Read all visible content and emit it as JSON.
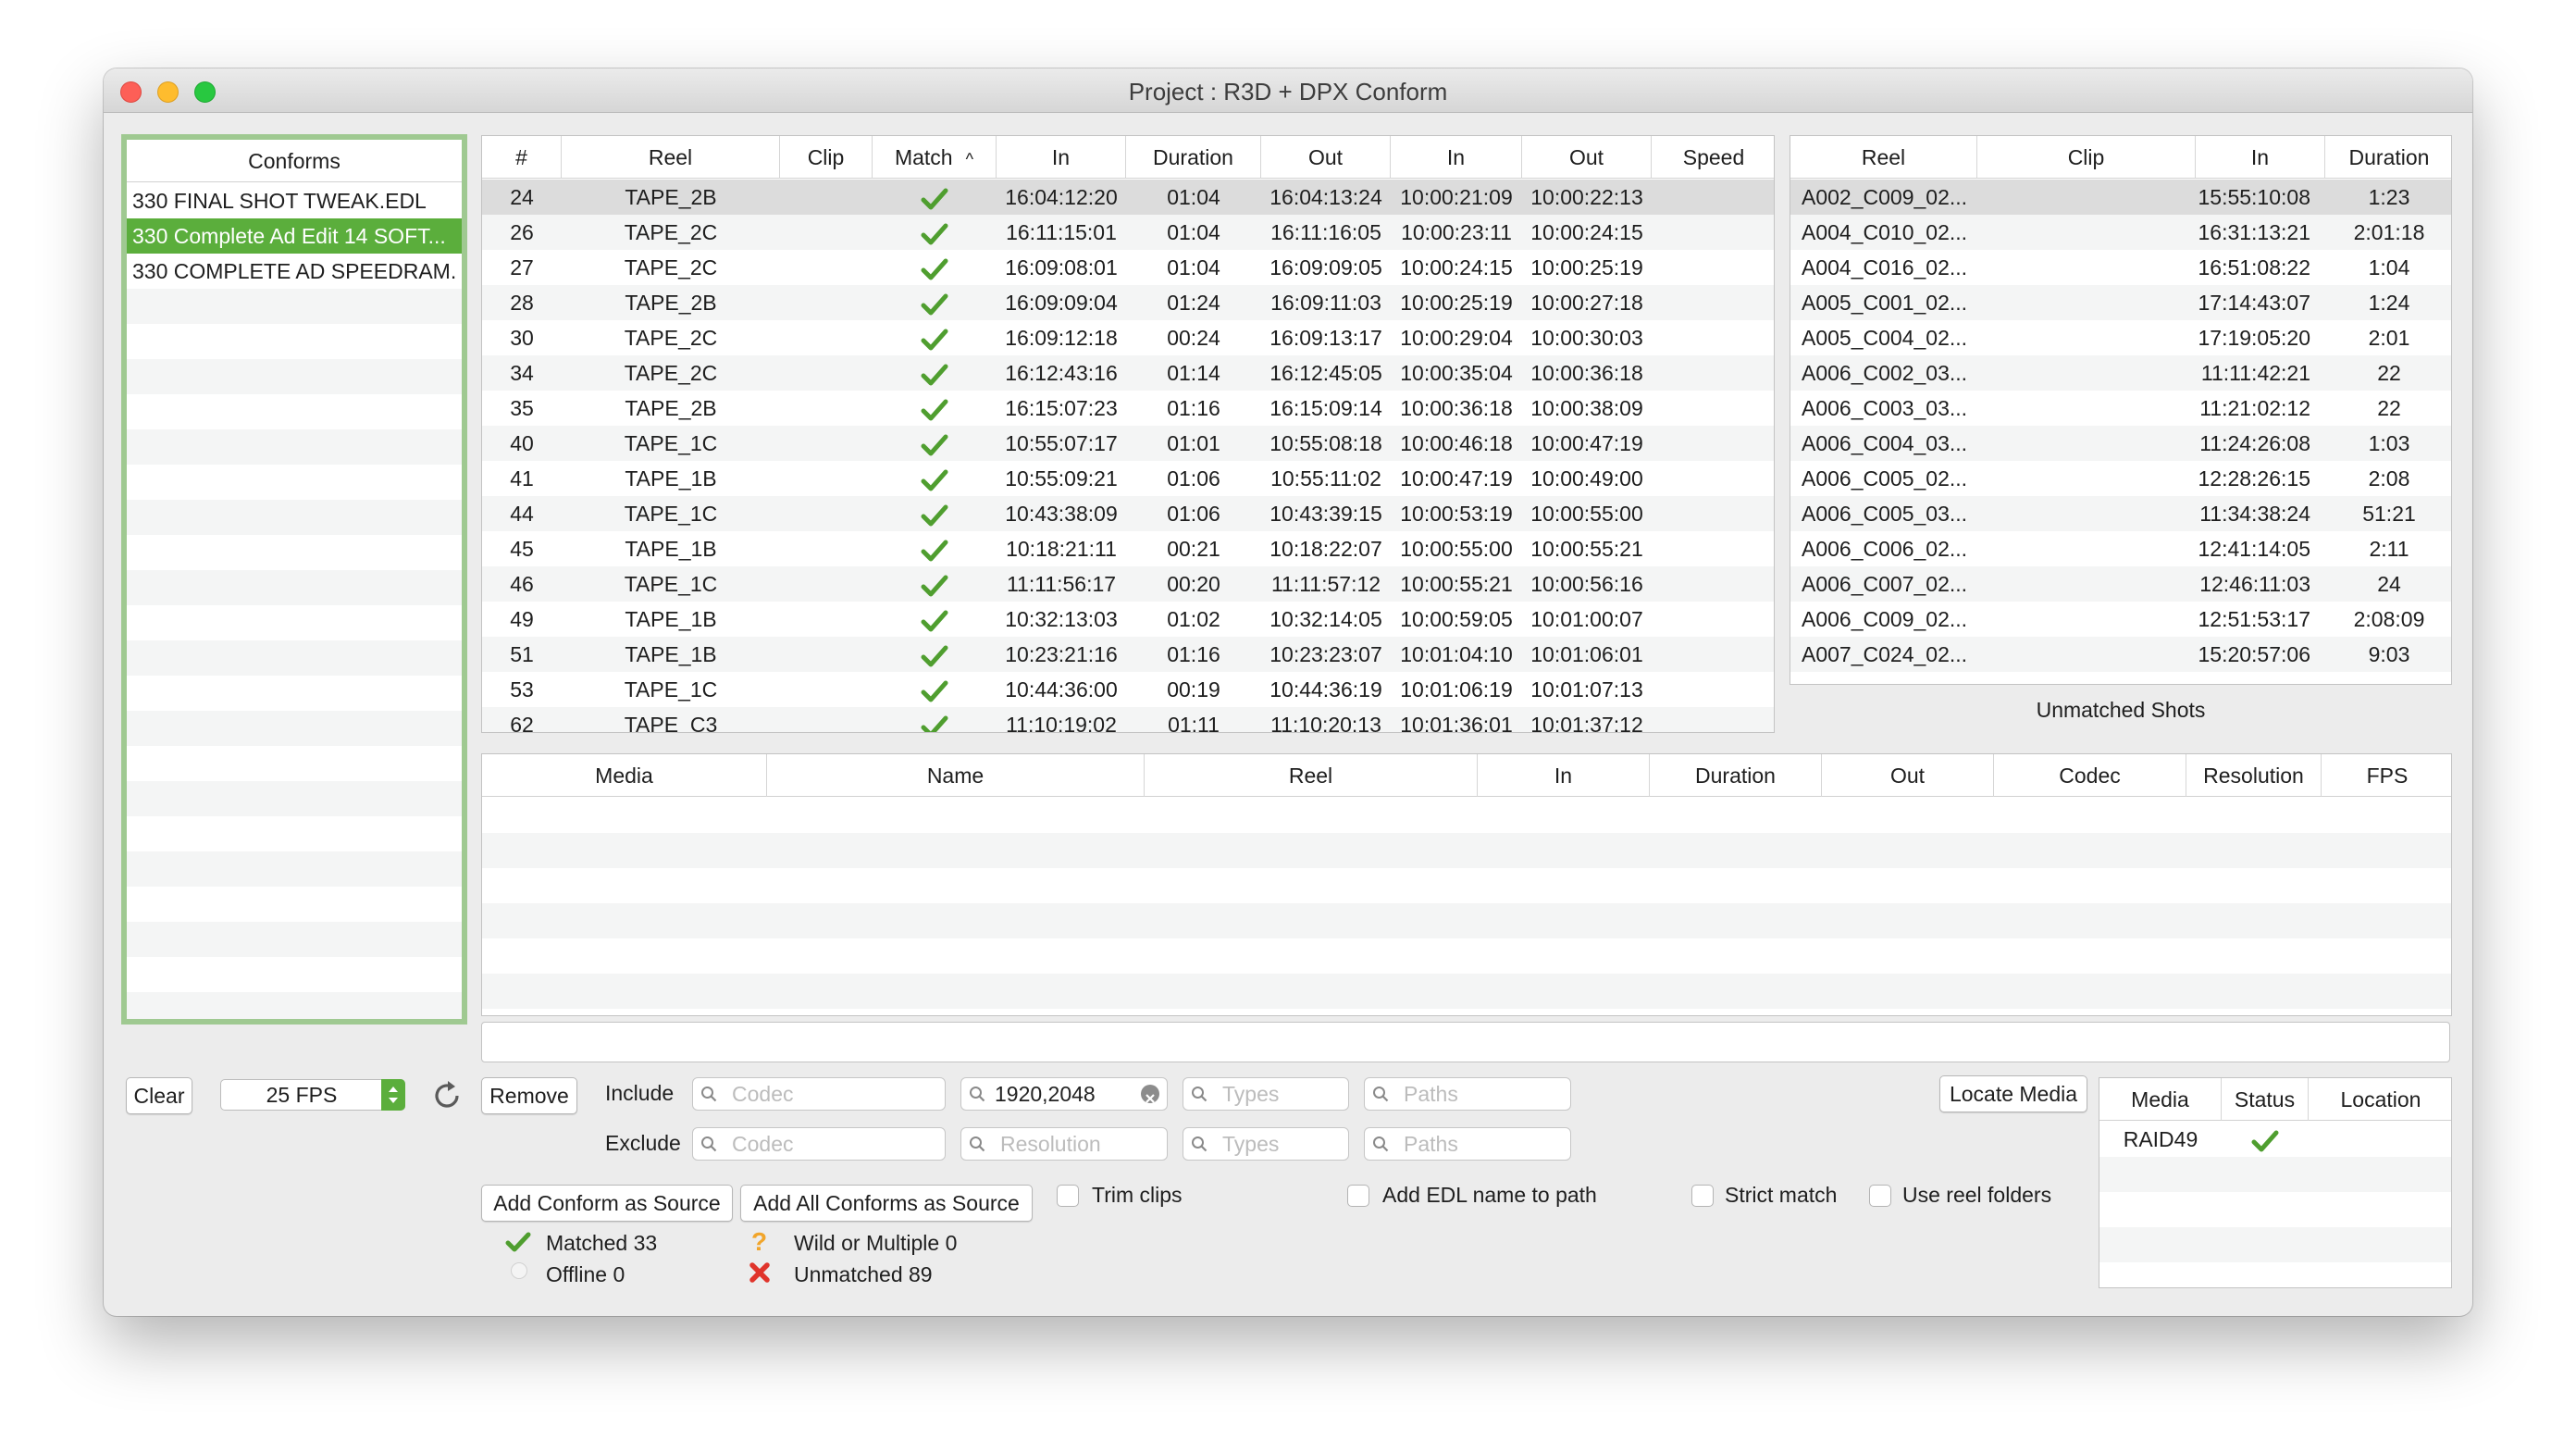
{
  "window": {
    "title": "Project : R3D + DPX Conform"
  },
  "conforms": {
    "header": "Conforms",
    "items": [
      "330  FINAL SHOT TWEAK.EDL",
      "330 Complete Ad Edit 14 SOFT...",
      "330 COMPLETE AD SPEEDRAM..."
    ],
    "selected_index": 1
  },
  "events": {
    "headers": [
      "#",
      "Reel",
      "Clip",
      "Match",
      "In",
      "Duration",
      "Out",
      "In",
      "Out",
      "Speed"
    ],
    "sort_indicator": "^",
    "rows": [
      [
        "24",
        "TAPE_2B",
        "",
        "check",
        "16:04:12:20",
        "01:04",
        "16:04:13:24",
        "10:00:21:09",
        "10:00:22:13",
        ""
      ],
      [
        "26",
        "TAPE_2C",
        "",
        "check",
        "16:11:15:01",
        "01:04",
        "16:11:16:05",
        "10:00:23:11",
        "10:00:24:15",
        ""
      ],
      [
        "27",
        "TAPE_2C",
        "",
        "check",
        "16:09:08:01",
        "01:04",
        "16:09:09:05",
        "10:00:24:15",
        "10:00:25:19",
        ""
      ],
      [
        "28",
        "TAPE_2B",
        "",
        "check",
        "16:09:09:04",
        "01:24",
        "16:09:11:03",
        "10:00:25:19",
        "10:00:27:18",
        ""
      ],
      [
        "30",
        "TAPE_2C",
        "",
        "check",
        "16:09:12:18",
        "00:24",
        "16:09:13:17",
        "10:00:29:04",
        "10:00:30:03",
        ""
      ],
      [
        "34",
        "TAPE_2C",
        "",
        "check",
        "16:12:43:16",
        "01:14",
        "16:12:45:05",
        "10:00:35:04",
        "10:00:36:18",
        ""
      ],
      [
        "35",
        "TAPE_2B",
        "",
        "check",
        "16:15:07:23",
        "01:16",
        "16:15:09:14",
        "10:00:36:18",
        "10:00:38:09",
        ""
      ],
      [
        "40",
        "TAPE_1C",
        "",
        "check",
        "10:55:07:17",
        "01:01",
        "10:55:08:18",
        "10:00:46:18",
        "10:00:47:19",
        ""
      ],
      [
        "41",
        "TAPE_1B",
        "",
        "check",
        "10:55:09:21",
        "01:06",
        "10:55:11:02",
        "10:00:47:19",
        "10:00:49:00",
        ""
      ],
      [
        "44",
        "TAPE_1C",
        "",
        "check",
        "10:43:38:09",
        "01:06",
        "10:43:39:15",
        "10:00:53:19",
        "10:00:55:00",
        ""
      ],
      [
        "45",
        "TAPE_1B",
        "",
        "check",
        "10:18:21:11",
        "00:21",
        "10:18:22:07",
        "10:00:55:00",
        "10:00:55:21",
        ""
      ],
      [
        "46",
        "TAPE_1C",
        "",
        "check",
        "11:11:56:17",
        "00:20",
        "11:11:57:12",
        "10:00:55:21",
        "10:00:56:16",
        ""
      ],
      [
        "49",
        "TAPE_1B",
        "",
        "check",
        "10:32:13:03",
        "01:02",
        "10:32:14:05",
        "10:00:59:05",
        "10:01:00:07",
        ""
      ],
      [
        "51",
        "TAPE_1B",
        "",
        "check",
        "10:23:21:16",
        "01:16",
        "10:23:23:07",
        "10:01:04:10",
        "10:01:06:01",
        ""
      ],
      [
        "53",
        "TAPE_1C",
        "",
        "check",
        "10:44:36:00",
        "00:19",
        "10:44:36:19",
        "10:01:06:19",
        "10:01:07:13",
        ""
      ],
      [
        "62",
        "TAPE_C3",
        "",
        "check",
        "11:10:19:02",
        "01:11",
        "11:10:20:13",
        "10:01:36:01",
        "10:01:37:12",
        ""
      ]
    ]
  },
  "unmatched": {
    "headers": [
      "Reel",
      "Clip",
      "In",
      "Duration"
    ],
    "caption": "Unmatched Shots",
    "rows": [
      [
        "A002_C009_02...",
        "",
        "15:55:10:08",
        "1:23"
      ],
      [
        "A004_C010_02...",
        "",
        "16:31:13:21",
        "2:01:18"
      ],
      [
        "A004_C016_02...",
        "",
        "16:51:08:22",
        "1:04"
      ],
      [
        "A005_C001_02...",
        "",
        "17:14:43:07",
        "1:24"
      ],
      [
        "A005_C004_02...",
        "",
        "17:19:05:20",
        "2:01"
      ],
      [
        "A006_C002_03...",
        "",
        "11:11:42:21",
        "22"
      ],
      [
        "A006_C003_03...",
        "",
        "11:21:02:12",
        "22"
      ],
      [
        "A006_C004_03...",
        "",
        "11:24:26:08",
        "1:03"
      ],
      [
        "A006_C005_02...",
        "",
        "12:28:26:15",
        "2:08"
      ],
      [
        "A006_C005_03...",
        "",
        "11:34:38:24",
        "51:21"
      ],
      [
        "A006_C006_02...",
        "",
        "12:41:14:05",
        "2:11"
      ],
      [
        "A006_C007_02...",
        "",
        "12:46:11:03",
        "24"
      ],
      [
        "A006_C009_02...",
        "",
        "12:51:53:17",
        "2:08:09"
      ],
      [
        "A007_C024_02...",
        "",
        "15:20:57:06",
        "9:03"
      ]
    ]
  },
  "media": {
    "headers": [
      "Media",
      "Name",
      "Reel",
      "In",
      "Duration",
      "Out",
      "Codec",
      "Resolution",
      "FPS"
    ]
  },
  "controls": {
    "clear_label": "Clear",
    "fps_value": "25 FPS",
    "remove_label": "Remove",
    "include_label": "Include",
    "exclude_label": "Exclude",
    "include_codec_ph": "Codec",
    "include_resolution_value": "1920,2048",
    "include_types_ph": "Types",
    "include_paths_ph": "Paths",
    "exclude_codec_ph": "Codec",
    "exclude_resolution_ph": "Resolution",
    "exclude_types_ph": "Types",
    "exclude_paths_ph": "Paths",
    "add_conform_label": "Add Conform as Source",
    "add_all_conforms_label": "Add All Conforms as Source",
    "trim_clips_label": "Trim clips",
    "add_edl_label": "Add EDL name to path",
    "strict_match_label": "Strict match",
    "use_reel_label": "Use reel folders",
    "locate_media_label": "Locate Media"
  },
  "stats": {
    "matched": "Matched 33",
    "offline": "Offline 0",
    "wild": "Wild or Multiple 0",
    "unmatched": "Unmatched 89"
  },
  "locations": {
    "headers": [
      "Media",
      "Status",
      "Location"
    ],
    "rows": [
      [
        "RAID49",
        "check",
        ""
      ]
    ]
  },
  "colors": {
    "accent_green": "#5bae3c",
    "check_green": "#4f9e2f",
    "error_red": "#e0342b",
    "warn_orange": "#f1a52b"
  }
}
